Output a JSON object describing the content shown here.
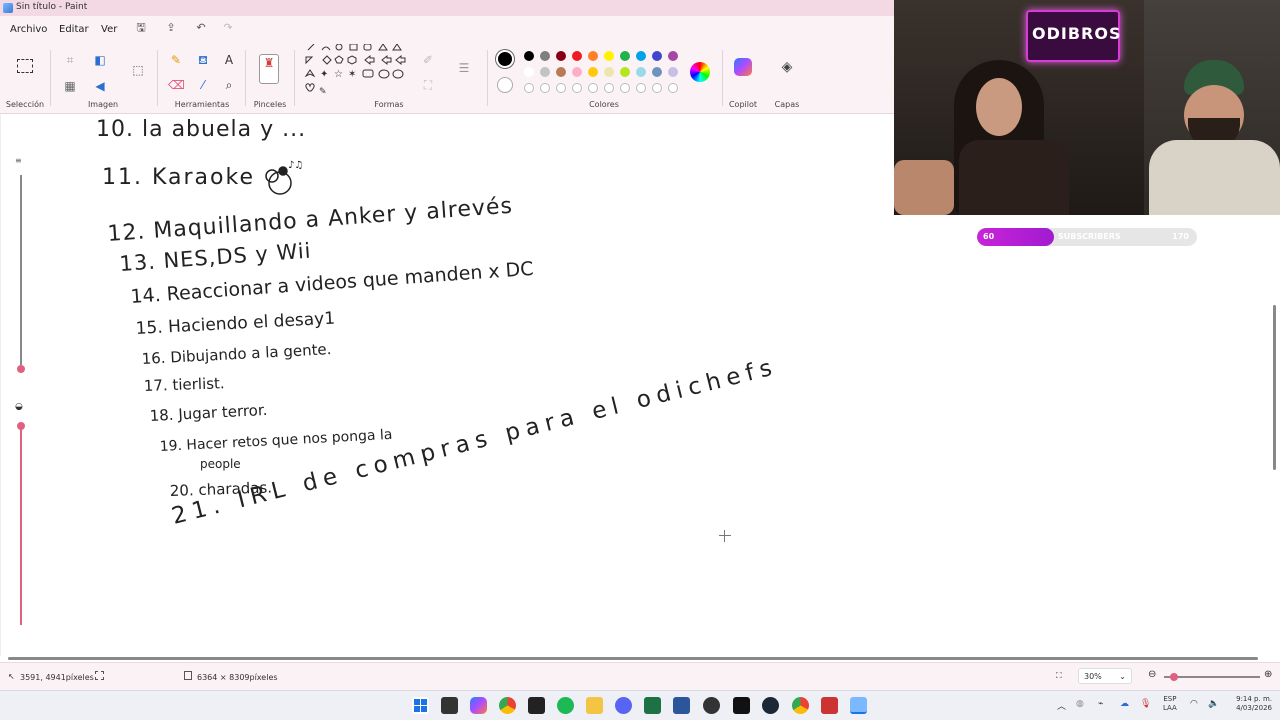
{
  "window": {
    "title": "Sin título - Paint"
  },
  "menu": {
    "items": [
      "Archivo",
      "Editar",
      "Ver"
    ]
  },
  "ribbon": {
    "groups": {
      "seleccion": "Selección",
      "imagen": "Imagen",
      "herramientas": "Herramientas",
      "pinceles": "Pinceles",
      "formas": "Formas",
      "colores": "Colores",
      "copilot": "Copilot",
      "capas": "Capas"
    },
    "colors_row1": [
      "#000000",
      "#7f7f7f",
      "#880015",
      "#ed1c24",
      "#ff7f27",
      "#fff200",
      "#22b14c",
      "#00a2e8",
      "#3f48cc",
      "#a349a4"
    ],
    "colors_row2": [
      "#ffffff",
      "#c3c3c3",
      "#b97a57",
      "#ffaec9",
      "#ffc90e",
      "#efe4b0",
      "#b5e61d",
      "#99d9ea",
      "#7092be",
      "#c8bfe7"
    ],
    "selected_color": "#000000"
  },
  "canvas": {
    "lines": [
      "10. la abuela y ...",
      "11. Karaoke",
      "12. Maquillando a Anker y alrevés",
      "13. NES,DS y Wii",
      "14. Reaccionar a videos que manden x DC",
      "15. Haciendo el desay1",
      "16. Dibujando a la gente.",
      "17. tierlist.",
      "18. Jugar terror.",
      "19. Hacer retos que nos ponga la",
      "people",
      "20. charadas.",
      "21. IRL de compras para el odichefs"
    ]
  },
  "status": {
    "cursor_pos": "3591, 4941píxeles",
    "canvas_size": "6364 × 8309píxeles",
    "zoom": "30%"
  },
  "taskbar": {
    "lang_top": "ESP",
    "lang_bottom": "LAA",
    "time": "9:14 p. m.",
    "date": "4/03/2026"
  },
  "overlay": {
    "channel_name": "ODIBROS",
    "sub_current": "60",
    "sub_label": "SUBSCRIBERS",
    "sub_goal": "170",
    "sub_progress": 0.35
  }
}
